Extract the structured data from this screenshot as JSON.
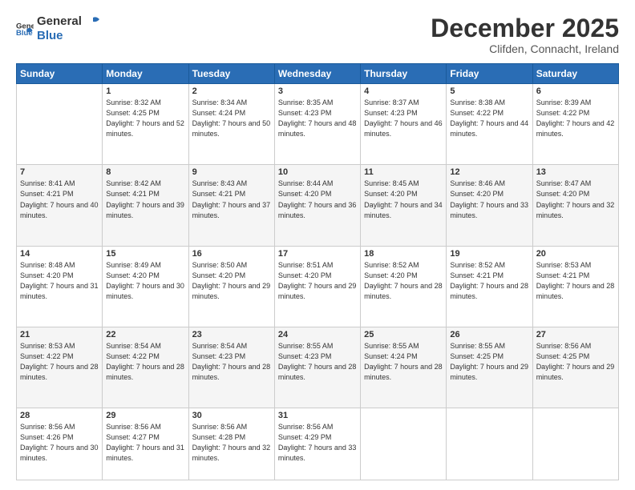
{
  "logo": {
    "general": "General",
    "blue": "Blue"
  },
  "header": {
    "month": "December 2025",
    "location": "Clifden, Connacht, Ireland"
  },
  "weekdays": [
    "Sunday",
    "Monday",
    "Tuesday",
    "Wednesday",
    "Thursday",
    "Friday",
    "Saturday"
  ],
  "weeks": [
    [
      {
        "day": "",
        "sunrise": "",
        "sunset": "",
        "daylight": ""
      },
      {
        "day": "1",
        "sunrise": "Sunrise: 8:32 AM",
        "sunset": "Sunset: 4:25 PM",
        "daylight": "Daylight: 7 hours and 52 minutes."
      },
      {
        "day": "2",
        "sunrise": "Sunrise: 8:34 AM",
        "sunset": "Sunset: 4:24 PM",
        "daylight": "Daylight: 7 hours and 50 minutes."
      },
      {
        "day": "3",
        "sunrise": "Sunrise: 8:35 AM",
        "sunset": "Sunset: 4:23 PM",
        "daylight": "Daylight: 7 hours and 48 minutes."
      },
      {
        "day": "4",
        "sunrise": "Sunrise: 8:37 AM",
        "sunset": "Sunset: 4:23 PM",
        "daylight": "Daylight: 7 hours and 46 minutes."
      },
      {
        "day": "5",
        "sunrise": "Sunrise: 8:38 AM",
        "sunset": "Sunset: 4:22 PM",
        "daylight": "Daylight: 7 hours and 44 minutes."
      },
      {
        "day": "6",
        "sunrise": "Sunrise: 8:39 AM",
        "sunset": "Sunset: 4:22 PM",
        "daylight": "Daylight: 7 hours and 42 minutes."
      }
    ],
    [
      {
        "day": "7",
        "sunrise": "Sunrise: 8:41 AM",
        "sunset": "Sunset: 4:21 PM",
        "daylight": "Daylight: 7 hours and 40 minutes."
      },
      {
        "day": "8",
        "sunrise": "Sunrise: 8:42 AM",
        "sunset": "Sunset: 4:21 PM",
        "daylight": "Daylight: 7 hours and 39 minutes."
      },
      {
        "day": "9",
        "sunrise": "Sunrise: 8:43 AM",
        "sunset": "Sunset: 4:21 PM",
        "daylight": "Daylight: 7 hours and 37 minutes."
      },
      {
        "day": "10",
        "sunrise": "Sunrise: 8:44 AM",
        "sunset": "Sunset: 4:20 PM",
        "daylight": "Daylight: 7 hours and 36 minutes."
      },
      {
        "day": "11",
        "sunrise": "Sunrise: 8:45 AM",
        "sunset": "Sunset: 4:20 PM",
        "daylight": "Daylight: 7 hours and 34 minutes."
      },
      {
        "day": "12",
        "sunrise": "Sunrise: 8:46 AM",
        "sunset": "Sunset: 4:20 PM",
        "daylight": "Daylight: 7 hours and 33 minutes."
      },
      {
        "day": "13",
        "sunrise": "Sunrise: 8:47 AM",
        "sunset": "Sunset: 4:20 PM",
        "daylight": "Daylight: 7 hours and 32 minutes."
      }
    ],
    [
      {
        "day": "14",
        "sunrise": "Sunrise: 8:48 AM",
        "sunset": "Sunset: 4:20 PM",
        "daylight": "Daylight: 7 hours and 31 minutes."
      },
      {
        "day": "15",
        "sunrise": "Sunrise: 8:49 AM",
        "sunset": "Sunset: 4:20 PM",
        "daylight": "Daylight: 7 hours and 30 minutes."
      },
      {
        "day": "16",
        "sunrise": "Sunrise: 8:50 AM",
        "sunset": "Sunset: 4:20 PM",
        "daylight": "Daylight: 7 hours and 29 minutes."
      },
      {
        "day": "17",
        "sunrise": "Sunrise: 8:51 AM",
        "sunset": "Sunset: 4:20 PM",
        "daylight": "Daylight: 7 hours and 29 minutes."
      },
      {
        "day": "18",
        "sunrise": "Sunrise: 8:52 AM",
        "sunset": "Sunset: 4:20 PM",
        "daylight": "Daylight: 7 hours and 28 minutes."
      },
      {
        "day": "19",
        "sunrise": "Sunrise: 8:52 AM",
        "sunset": "Sunset: 4:21 PM",
        "daylight": "Daylight: 7 hours and 28 minutes."
      },
      {
        "day": "20",
        "sunrise": "Sunrise: 8:53 AM",
        "sunset": "Sunset: 4:21 PM",
        "daylight": "Daylight: 7 hours and 28 minutes."
      }
    ],
    [
      {
        "day": "21",
        "sunrise": "Sunrise: 8:53 AM",
        "sunset": "Sunset: 4:22 PM",
        "daylight": "Daylight: 7 hours and 28 minutes."
      },
      {
        "day": "22",
        "sunrise": "Sunrise: 8:54 AM",
        "sunset": "Sunset: 4:22 PM",
        "daylight": "Daylight: 7 hours and 28 minutes."
      },
      {
        "day": "23",
        "sunrise": "Sunrise: 8:54 AM",
        "sunset": "Sunset: 4:23 PM",
        "daylight": "Daylight: 7 hours and 28 minutes."
      },
      {
        "day": "24",
        "sunrise": "Sunrise: 8:55 AM",
        "sunset": "Sunset: 4:23 PM",
        "daylight": "Daylight: 7 hours and 28 minutes."
      },
      {
        "day": "25",
        "sunrise": "Sunrise: 8:55 AM",
        "sunset": "Sunset: 4:24 PM",
        "daylight": "Daylight: 7 hours and 28 minutes."
      },
      {
        "day": "26",
        "sunrise": "Sunrise: 8:55 AM",
        "sunset": "Sunset: 4:25 PM",
        "daylight": "Daylight: 7 hours and 29 minutes."
      },
      {
        "day": "27",
        "sunrise": "Sunrise: 8:56 AM",
        "sunset": "Sunset: 4:25 PM",
        "daylight": "Daylight: 7 hours and 29 minutes."
      }
    ],
    [
      {
        "day": "28",
        "sunrise": "Sunrise: 8:56 AM",
        "sunset": "Sunset: 4:26 PM",
        "daylight": "Daylight: 7 hours and 30 minutes."
      },
      {
        "day": "29",
        "sunrise": "Sunrise: 8:56 AM",
        "sunset": "Sunset: 4:27 PM",
        "daylight": "Daylight: 7 hours and 31 minutes."
      },
      {
        "day": "30",
        "sunrise": "Sunrise: 8:56 AM",
        "sunset": "Sunset: 4:28 PM",
        "daylight": "Daylight: 7 hours and 32 minutes."
      },
      {
        "day": "31",
        "sunrise": "Sunrise: 8:56 AM",
        "sunset": "Sunset: 4:29 PM",
        "daylight": "Daylight: 7 hours and 33 minutes."
      },
      {
        "day": "",
        "sunrise": "",
        "sunset": "",
        "daylight": ""
      },
      {
        "day": "",
        "sunrise": "",
        "sunset": "",
        "daylight": ""
      },
      {
        "day": "",
        "sunrise": "",
        "sunset": "",
        "daylight": ""
      }
    ]
  ]
}
